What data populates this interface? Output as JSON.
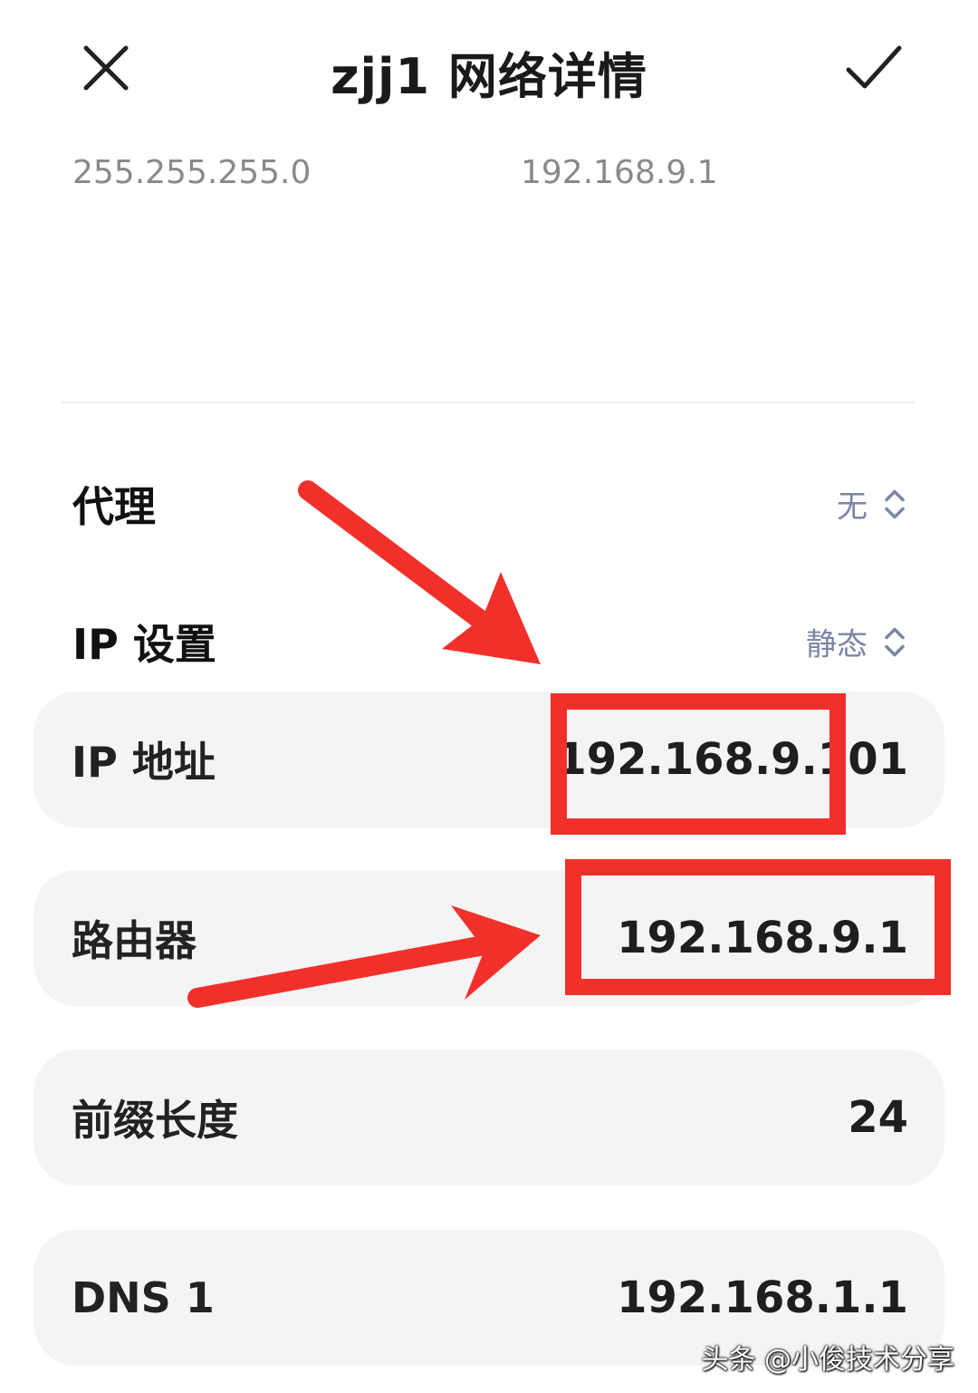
{
  "header": {
    "title": "zjj1 网络详情",
    "close_icon": "close-icon",
    "confirm_icon": "check-icon"
  },
  "top_values": {
    "left": "255.255.255.0",
    "right": "192.168.9.1"
  },
  "proxy": {
    "label": "代理",
    "value": "无"
  },
  "ip_settings": {
    "label": "IP 设置",
    "value": "静态"
  },
  "fields": {
    "ip_address": {
      "label": "IP 地址",
      "value": "192.168.9.101"
    },
    "router": {
      "label": "路由器",
      "value": "192.168.9.1"
    },
    "prefix_length": {
      "label": "前缀长度",
      "value": "24"
    },
    "dns1": {
      "label": "DNS 1",
      "value": "192.168.1.1"
    }
  },
  "annotation_color": "#f2302b",
  "watermark": "头条 @小俊技术分享"
}
